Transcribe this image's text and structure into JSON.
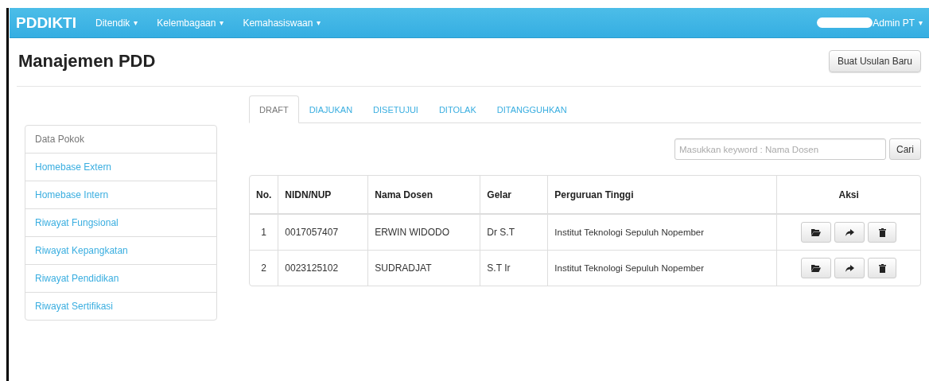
{
  "navbar": {
    "brand": "PDDIKTI",
    "menus": [
      {
        "label": "Ditendik",
        "caret": "▾"
      },
      {
        "label": "Kelembagaan",
        "caret": "▾"
      },
      {
        "label": "Kemahasiswaan",
        "caret": "▾"
      }
    ],
    "user": {
      "label": "Admin PT",
      "caret": "▾"
    }
  },
  "page": {
    "title": "Manajemen PDD",
    "new_button": "Buat Usulan Baru"
  },
  "sidebar": {
    "items": [
      {
        "label": "Data Pokok",
        "selected": true
      },
      {
        "label": "Homebase Extern",
        "selected": false
      },
      {
        "label": "Homebase Intern",
        "selected": false
      },
      {
        "label": "Riwayat Fungsional",
        "selected": false
      },
      {
        "label": "Riwayat Kepangkatan",
        "selected": false
      },
      {
        "label": "Riwayat Pendidikan",
        "selected": false
      },
      {
        "label": "Riwayat Sertifikasi",
        "selected": false
      }
    ]
  },
  "tabs": [
    {
      "label": "DRAFT",
      "selected": true
    },
    {
      "label": "DIAJUKAN",
      "selected": false
    },
    {
      "label": "DISETUJUI",
      "selected": false
    },
    {
      "label": "DITOLAK",
      "selected": false
    },
    {
      "label": "DITANGGUHKAN",
      "selected": false
    }
  ],
  "search": {
    "placeholder": "Masukkan keyword : Nama Dosen",
    "button": "Cari"
  },
  "table": {
    "columns": [
      "No.",
      "NIDN/NUP",
      "Nama Dosen",
      "Gelar",
      "Perguruan Tinggi",
      "Aksi"
    ],
    "rows": [
      {
        "no": "1",
        "nidn": "0017057407",
        "nama": "ERWIN WIDODO",
        "gelar": "Dr S.T",
        "pt": "Institut Teknologi Sepuluh Nopember"
      },
      {
        "no": "2",
        "nidn": "0023125102",
        "nama": "SUDRADJAT",
        "gelar": "S.T Ir",
        "pt": "Institut Teknologi Sepuluh Nopember"
      }
    ]
  }
}
